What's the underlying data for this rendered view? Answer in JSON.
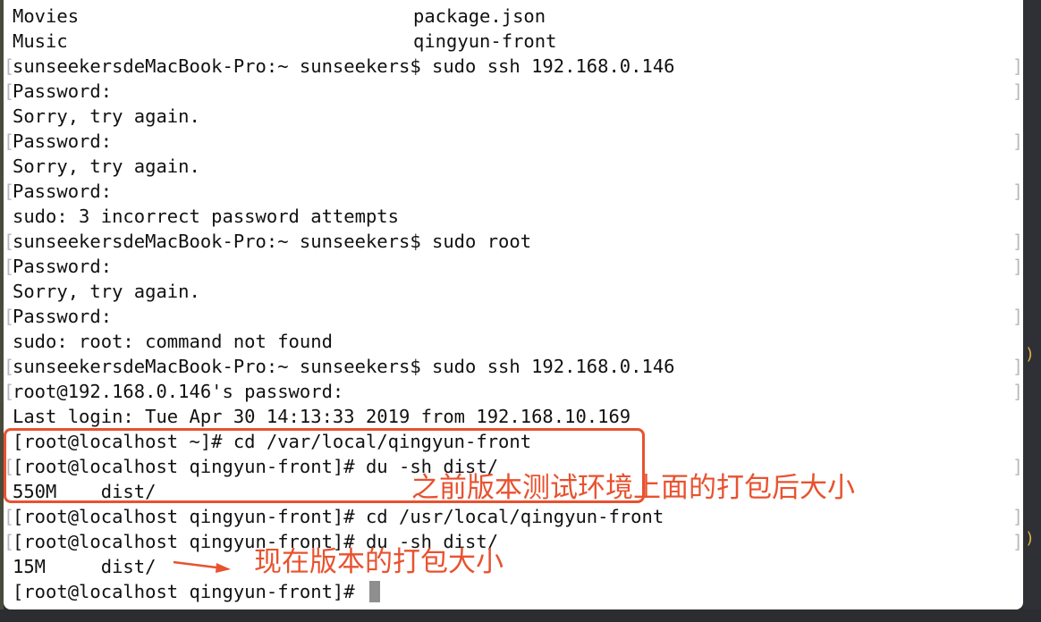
{
  "terminal": {
    "lines": [
      {
        "bracket": false,
        "text": "Movies",
        "col2": "package.json"
      },
      {
        "bracket": false,
        "text": "Music",
        "col2": "qingyun-front"
      },
      {
        "bracket": true,
        "text": "sunseekersdeMacBook-Pro:~ sunseekers$ sudo ssh 192.168.0.146"
      },
      {
        "bracket": true,
        "text": "Password:"
      },
      {
        "bracket": false,
        "text": "Sorry, try again."
      },
      {
        "bracket": true,
        "text": "Password:"
      },
      {
        "bracket": false,
        "text": "Sorry, try again."
      },
      {
        "bracket": true,
        "text": "Password:"
      },
      {
        "bracket": false,
        "text": "sudo: 3 incorrect password attempts"
      },
      {
        "bracket": true,
        "text": "sunseekersdeMacBook-Pro:~ sunseekers$ sudo root"
      },
      {
        "bracket": true,
        "text": "Password:"
      },
      {
        "bracket": false,
        "text": "Sorry, try again."
      },
      {
        "bracket": true,
        "text": "Password:"
      },
      {
        "bracket": false,
        "text": "sudo: root: command not found"
      },
      {
        "bracket": true,
        "text": "sunseekersdeMacBook-Pro:~ sunseekers$ sudo ssh 192.168.0.146"
      },
      {
        "bracket": true,
        "text": "root@192.168.0.146's password:"
      },
      {
        "bracket": false,
        "text": "Last login: Tue Apr 30 14:13:33 2019 from 192.168.10.169"
      },
      {
        "bracket": false,
        "text": "[root@localhost ~]# cd /var/local/qingyun-front"
      },
      {
        "bracket": true,
        "text": "[root@localhost qingyun-front]# du -sh dist/"
      },
      {
        "bracket": false,
        "text": "550M    dist/"
      },
      {
        "bracket": true,
        "text": "[root@localhost qingyun-front]# cd /usr/local/qingyun-front"
      },
      {
        "bracket": true,
        "text": "[root@localhost qingyun-front]# du -sh dist/"
      },
      {
        "bracket": false,
        "text": "15M     dist/"
      },
      {
        "bracket": false,
        "text": "[root@localhost qingyun-front]# ",
        "cursor": true
      }
    ]
  },
  "annotations": {
    "previous_size": "之前版本测试环境上面的打包后大小",
    "current_size": "现在版本的打包大小"
  },
  "colors": {
    "annotation": "#e8522f",
    "terminal_bg": "#ffffff",
    "text": "#111111"
  }
}
